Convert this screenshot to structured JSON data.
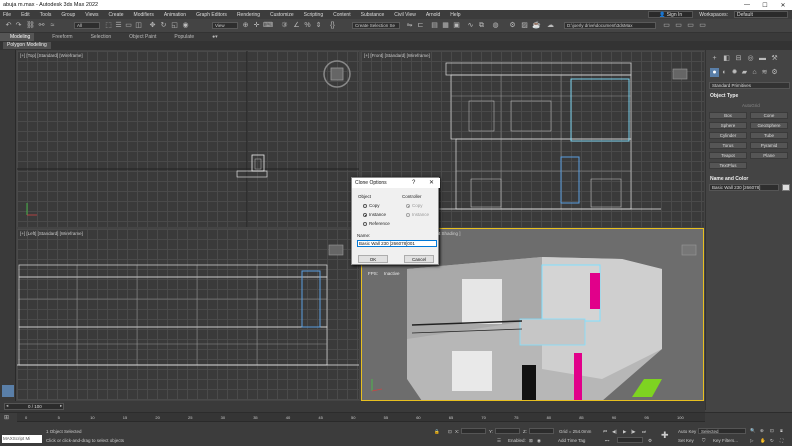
{
  "title_bar": {
    "text": "abuja m.max - Autodesk 3ds Max 2022",
    "minimize": "—",
    "maximize": "☐",
    "close": "✕"
  },
  "menu": [
    "File",
    "Edit",
    "Tools",
    "Group",
    "Views",
    "Create",
    "Modifiers",
    "Animation",
    "Graph Editors",
    "Rendering",
    "Customize",
    "Scripting",
    "Content",
    "Substance",
    "Civil View",
    "Arnold",
    "Help"
  ],
  "account": {
    "signin": "Sign In",
    "workspaces_label": "Workspaces:",
    "workspace": "Default"
  },
  "toolbar": {
    "filter": "All",
    "view": "View",
    "selection_set": "Create Selection Se",
    "path": "D:\\joerly drive\\document\\3dsMax"
  },
  "ribbon": {
    "tabs": [
      "Modeling",
      "Freeform",
      "Selection",
      "Object Paint",
      "Populate"
    ],
    "sub": "Polygon Modeling"
  },
  "viewports": {
    "top": "[+] [Top] [Standard] [Wireframe]",
    "front": "[+] [Front] [Standard] [Wireframe]",
    "left": "[+] [Left] [Standard] [Wireframe]",
    "persp": "it Shading ]",
    "fps": "FPS:",
    "fps_value": "Inactive"
  },
  "command_panel": {
    "category": "Standard Primitives",
    "object_type": "Object Type",
    "autogrid": "AutoGrid",
    "buttons": [
      "Box",
      "Cone",
      "Sphere",
      "GeoSphere",
      "Cylinder",
      "Tube",
      "Torus",
      "Pyramid",
      "Teapot",
      "Plane",
      "TextPlus"
    ],
    "name_and_color": "Name and Color",
    "object_name": "Basic Wall 230 [266078]"
  },
  "dialog": {
    "title": "Clone Options",
    "help": "?",
    "close": "✕",
    "object_label": "Object",
    "controller_label": "Controller",
    "options": [
      "Copy",
      "Instance",
      "Reference"
    ],
    "controller_options": [
      "Copy",
      "Instance"
    ],
    "name_label": "Name:",
    "name_value": "Basic Wall 230 [266078]001",
    "ok": "OK",
    "cancel": "Cancel"
  },
  "timeline": {
    "frame": "0 / 100",
    "ticks": [
      "0",
      "5",
      "10",
      "15",
      "20",
      "25",
      "30",
      "35",
      "40",
      "45",
      "50",
      "55",
      "60",
      "65",
      "70",
      "75",
      "80",
      "85",
      "90",
      "95",
      "100"
    ]
  },
  "status": {
    "maxscript": "MAXScript Mi",
    "selected": "1 Object Selected",
    "prompt": "Click or click-and-drag to select objects",
    "x_label": "X:",
    "y_label": "Y:",
    "z_label": "Z:",
    "grid": "Grid = 254.0mm",
    "enabled": "Enabled:",
    "add_time_tag": "Add Time Tag",
    "auto_key": "Auto Key",
    "selected_mode": "Selected",
    "set_key": "Set Key",
    "key_filters": "Key Filters..."
  }
}
